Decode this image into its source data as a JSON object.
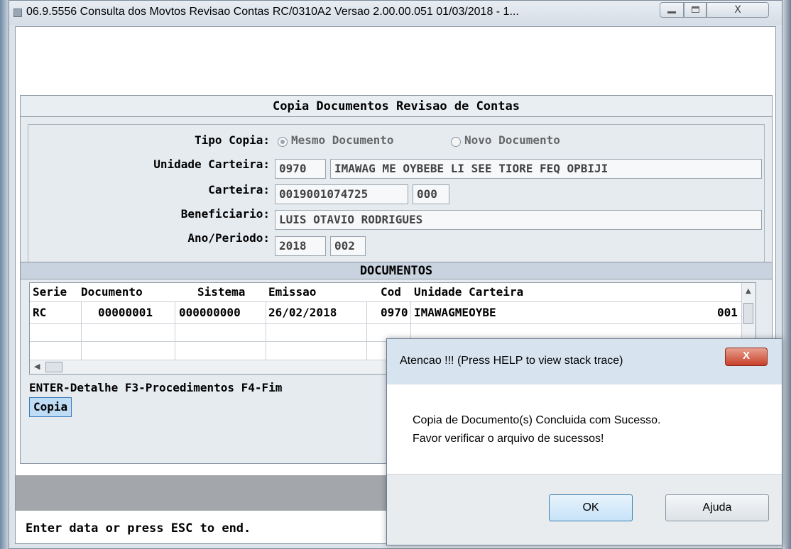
{
  "window": {
    "title": "06.9.5556 Consulta  dos Movtos Revisao Contas RC/0310A2 Versao 2.00.00.051 01/03/2018 - 1...",
    "close_glyph": "X"
  },
  "form": {
    "header": "Copia Documentos Revisao de Contas",
    "tipo_copia_label": "Tipo Copia:",
    "tipo_copia_options": [
      "Mesmo Documento",
      "Novo Documento"
    ],
    "unidade_carteira_label": "Unidade Carteira:",
    "unidade_carteira_code": "0970",
    "unidade_carteira_name": "IMAWAG ME OYBEBE LI SEE TIORE FEQ OPBIJI",
    "carteira_label": "Carteira:",
    "carteira_value": "0019001074725",
    "carteira_suffix": "000",
    "beneficiario_label": "Beneficiario:",
    "beneficiario_value": "LUIS OTAVIO RODRIGUES",
    "ano_periodo_label": "Ano/Periodo:",
    "ano_value": "2018",
    "periodo_value": "002"
  },
  "documentos": {
    "header": "DOCUMENTOS",
    "columns": [
      "Serie",
      "Documento",
      "Sistema",
      "Emissao",
      "Cod",
      "Unidade Carteira"
    ],
    "rows": [
      {
        "serie": "RC",
        "documento": "00000001",
        "sistema": "000000000",
        "emissao": "26/02/2018",
        "cod": "0970",
        "unidade": "IMAWAGMEOYBE",
        "extra": "001"
      }
    ]
  },
  "hint": "ENTER-Detalhe F3-Procedimentos F4-Fim",
  "copia_button": "Copia",
  "status": "Enter data or press ESC to end.",
  "dialog": {
    "title": "Atencao !!! (Press HELP to view stack trace)",
    "close_glyph": "X",
    "message_line1": "Copia de Documento(s) Concluida com Sucesso.",
    "message_line2": "Favor verificar o arquivo de sucessos!",
    "ok_label": "OK",
    "help_label": "Ajuda"
  }
}
